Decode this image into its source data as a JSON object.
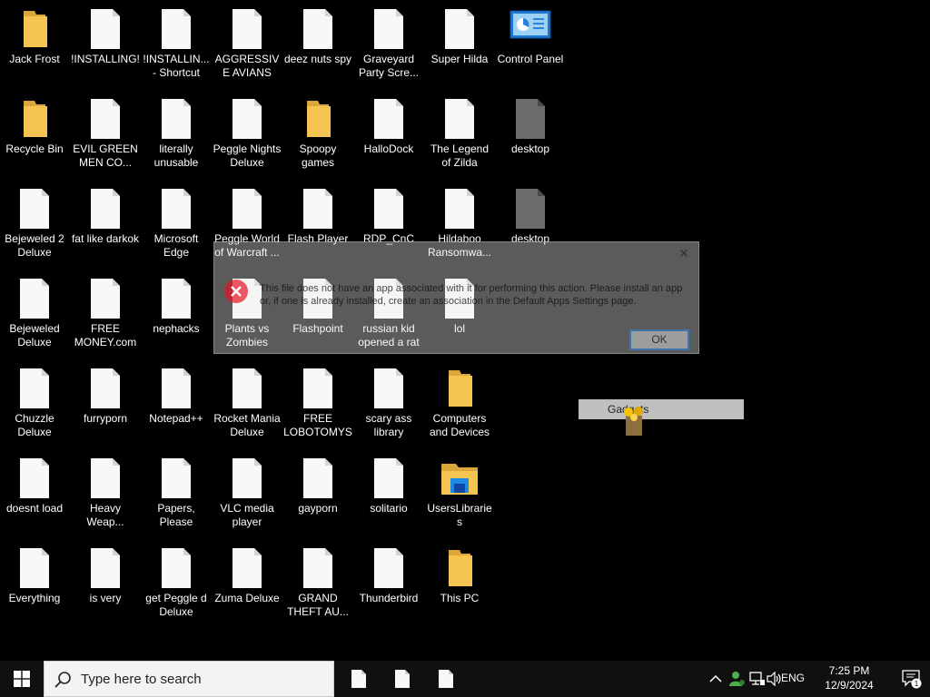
{
  "colors": {
    "folder": "#f5c451",
    "folder_dark": "#dba73a",
    "file": "#f8f8f8",
    "file_fold": "#d4d4d4",
    "taskbar": "#101010",
    "error_red": "#e81123"
  },
  "desktop": {
    "icons": [
      {
        "label": "Jack Frost",
        "type": "folder"
      },
      {
        "label": "!INSTALLING!",
        "type": "file"
      },
      {
        "label": "!INSTALLIN... - Shortcut",
        "type": "file"
      },
      {
        "label": "AGGRESSIVE AVIANS",
        "type": "file"
      },
      {
        "label": "deez nuts spy",
        "type": "file"
      },
      {
        "label": "Graveyard Party Scre...",
        "type": "file"
      },
      {
        "label": "Super Hilda",
        "type": "file"
      },
      {
        "label": "Control Panel",
        "type": "control-panel"
      },
      {
        "label": "Recycle Bin",
        "type": "folder"
      },
      {
        "label": "EVIL GREEN MEN CO...",
        "type": "file"
      },
      {
        "label": "literally unusable",
        "type": "file"
      },
      {
        "label": "Peggle Nights Deluxe",
        "type": "file"
      },
      {
        "label": "Spoopy games",
        "type": "folder"
      },
      {
        "label": "HalloDock",
        "type": "file"
      },
      {
        "label": "The Legend of Zilda",
        "type": "file"
      },
      {
        "label": "desktop",
        "type": "file-dark"
      },
      {
        "label": "Bejeweled 2 Deluxe",
        "type": "file"
      },
      {
        "label": "fat like darkok",
        "type": "file"
      },
      {
        "label": "Microsoft Edge",
        "type": "file"
      },
      {
        "label": "Peggle World of Warcraft ...",
        "type": "file"
      },
      {
        "label": "Flash Player",
        "type": "file"
      },
      {
        "label": "RDP_CnC",
        "type": "file"
      },
      {
        "label": "Hildaboo Ransomwa...",
        "type": "file"
      },
      {
        "label": "desktop",
        "type": "file-dark"
      },
      {
        "label": "Bejeweled Deluxe",
        "type": "file"
      },
      {
        "label": "FREE MONEY.com",
        "type": "file"
      },
      {
        "label": "nephacks",
        "type": "file"
      },
      {
        "label": "Plants vs Zombies",
        "type": "file"
      },
      {
        "label": "Flashpoint",
        "type": "file"
      },
      {
        "label": "russian kid opened a rat",
        "type": "file"
      },
      {
        "label": "lol",
        "type": "file"
      },
      {
        "label": "Chuzzle Deluxe",
        "type": "file"
      },
      {
        "label": "furryporn",
        "type": "file"
      },
      {
        "label": "Notepad++",
        "type": "file"
      },
      {
        "label": "Rocket Mania Deluxe",
        "type": "file"
      },
      {
        "label": "FREE LOBOTOMYS",
        "type": "file"
      },
      {
        "label": "scary ass library",
        "type": "file"
      },
      {
        "label": "Computers and Devices",
        "type": "folder"
      },
      {
        "label": "doesnt load",
        "type": "file"
      },
      {
        "label": "Heavy Weap...",
        "type": "file"
      },
      {
        "label": "Papers, Please",
        "type": "file"
      },
      {
        "label": "VLC media player",
        "type": "file"
      },
      {
        "label": "gayporn",
        "type": "file"
      },
      {
        "label": "solitario",
        "type": "file"
      },
      {
        "label": "UsersLibraries",
        "type": "libraries"
      },
      {
        "label": "Everything",
        "type": "file"
      },
      {
        "label": "is very",
        "type": "file"
      },
      {
        "label": "get Peggle d Deluxe",
        "type": "file"
      },
      {
        "label": "Zuma Deluxe",
        "type": "file"
      },
      {
        "label": "GRAND THEFT AU...",
        "type": "file"
      },
      {
        "label": "Thunderbird",
        "type": "file"
      },
      {
        "label": "This PC",
        "type": "folder"
      }
    ]
  },
  "dialog": {
    "message": "This file does not have an app associated with it for performing this action. Please install an app or, if one is already installed, create an association in the Default Apps Settings page.",
    "ok_label": "OK",
    "close_glyph": "✕",
    "icon": "error-icon"
  },
  "gadgets": {
    "label": "Gadgets",
    "icon": "gadgets-icon"
  },
  "taskbar": {
    "search_placeholder": "Type here to search",
    "start_icon": "windows-logo-icon",
    "pinned": [
      "file-icon",
      "file-icon",
      "file-icon"
    ],
    "tray": {
      "chevron": "^",
      "language": "ENG",
      "time": "7:25 PM",
      "date": "12/9/2024",
      "notification_count": "1"
    }
  }
}
